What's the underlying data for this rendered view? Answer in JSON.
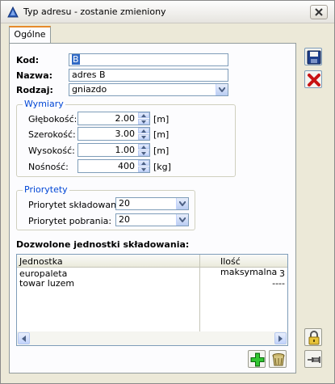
{
  "window": {
    "title": "Typ adresu - zostanie zmieniony"
  },
  "tabs": [
    {
      "label": "Ogólne"
    }
  ],
  "form": {
    "kod": {
      "label": "Kod:",
      "value": "B"
    },
    "nazwa": {
      "label": "Nazwa:",
      "value": "adres B"
    },
    "rodzaj": {
      "label": "Rodzaj:",
      "value": "gniazdo"
    }
  },
  "wymiary": {
    "title": "Wymiary",
    "rows": [
      {
        "label": "Głębokość:",
        "value": "2.00",
        "unit": "[m]"
      },
      {
        "label": "Szerokość:",
        "value": "3.00",
        "unit": "[m]"
      },
      {
        "label": "Wysokość:",
        "value": "1.00",
        "unit": "[m]"
      },
      {
        "label": "Nośność:",
        "value": "400",
        "unit": "[kg]"
      }
    ]
  },
  "priorytety": {
    "title": "Priorytety",
    "skladowania": {
      "label": "Priorytet składowania:",
      "value": "20"
    },
    "pobrania": {
      "label": "Priorytet pobrania:",
      "value": "20"
    }
  },
  "units_table": {
    "caption": "Dozwolone jednostki składowania:",
    "columns": [
      "Jednostka",
      "Ilość maksymalna"
    ],
    "rows": [
      [
        "europaleta",
        "3"
      ],
      [
        "towar luzem",
        "----"
      ]
    ]
  },
  "icons": {
    "save": "floppy-disk-icon",
    "cancel": "red-x-icon",
    "add": "green-plus-icon",
    "delete": "trash-bin-icon",
    "lock": "padlock-icon",
    "pin": "pushpin-icon"
  },
  "colors": {
    "accent": "#0046d5",
    "tab_highlight": "#e68b2c",
    "selection": "#316ac5"
  }
}
